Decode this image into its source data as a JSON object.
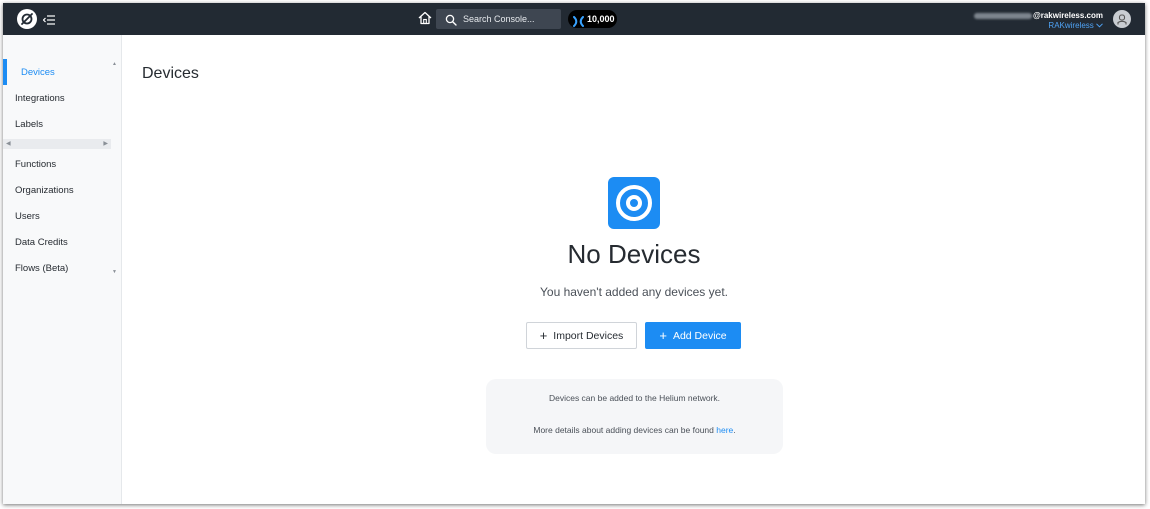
{
  "topbar": {
    "search_placeholder": "Search Console...",
    "data_credits": "10,000",
    "user_email_domain": "@rakwireless.com",
    "org_name": "RAKwireless",
    "icons": {
      "logo": "helium-logo-icon",
      "menu": "menu-collapse-icon",
      "home": "home-icon",
      "search": "search-icon",
      "credits": "data-credits-icon",
      "avatar": "user-avatar-icon",
      "org_dropdown": "chevron-down-icon"
    }
  },
  "sidebar": {
    "items": [
      {
        "label": "Devices"
      },
      {
        "label": "Integrations"
      },
      {
        "label": "Labels"
      },
      {
        "label": "Functions"
      },
      {
        "label": "Organizations"
      },
      {
        "label": "Users"
      },
      {
        "label": "Data Credits"
      },
      {
        "label": "Flows (Beta)"
      }
    ],
    "active_index": 0
  },
  "main": {
    "title": "Devices",
    "empty_state": {
      "icon": "device-target-icon",
      "heading": "No Devices",
      "subtext": "You haven't added any devices yet.",
      "import_label": "Import Devices",
      "add_label": "Add Device"
    },
    "info": {
      "line1": "Devices can be added to the Helium network.",
      "line2_prefix": "More details about adding devices can be found ",
      "link_text": "here",
      "line2_suffix": "."
    }
  },
  "colors": {
    "accent": "#1c8cf3",
    "topbar_bg": "#222a33",
    "sidebar_bg": "#f8f9fa",
    "info_bg": "#f5f6f8"
  }
}
